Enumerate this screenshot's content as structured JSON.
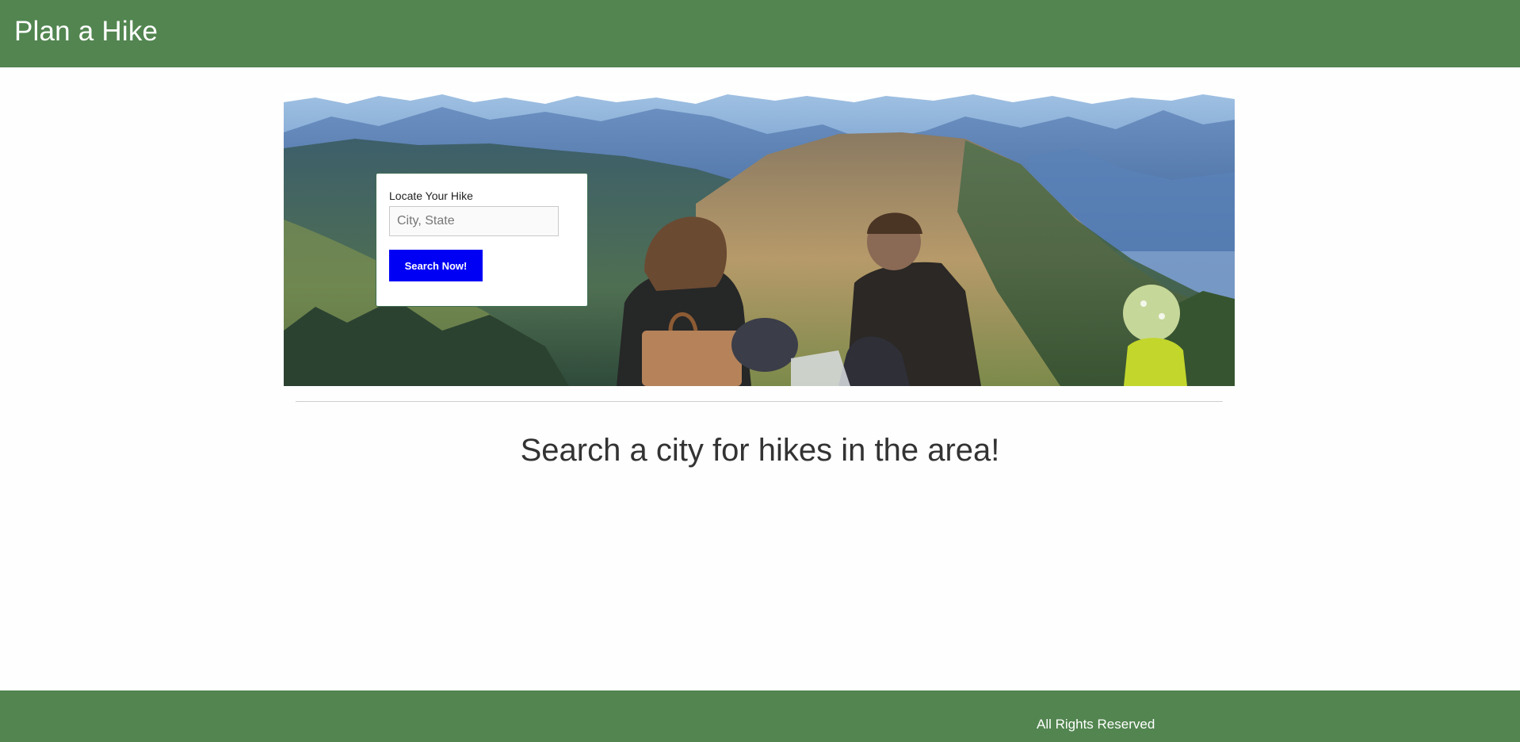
{
  "header": {
    "brand_title": "Plan a Hike"
  },
  "hero": {
    "image_icon": "family-hiking-mountains-photo",
    "search_form": {
      "label": "Locate Your Hike",
      "input_value": "",
      "input_placeholder": "City, State",
      "button_label": "Search Now!"
    }
  },
  "main": {
    "tagline": "Search a city for hikes in the area!"
  },
  "footer": {
    "text": "All Rights Reserved"
  },
  "colors": {
    "header_bg": "#528550",
    "footer_bg": "#528550",
    "button_bg": "#0000f5",
    "card_border": "#3f6f52"
  }
}
